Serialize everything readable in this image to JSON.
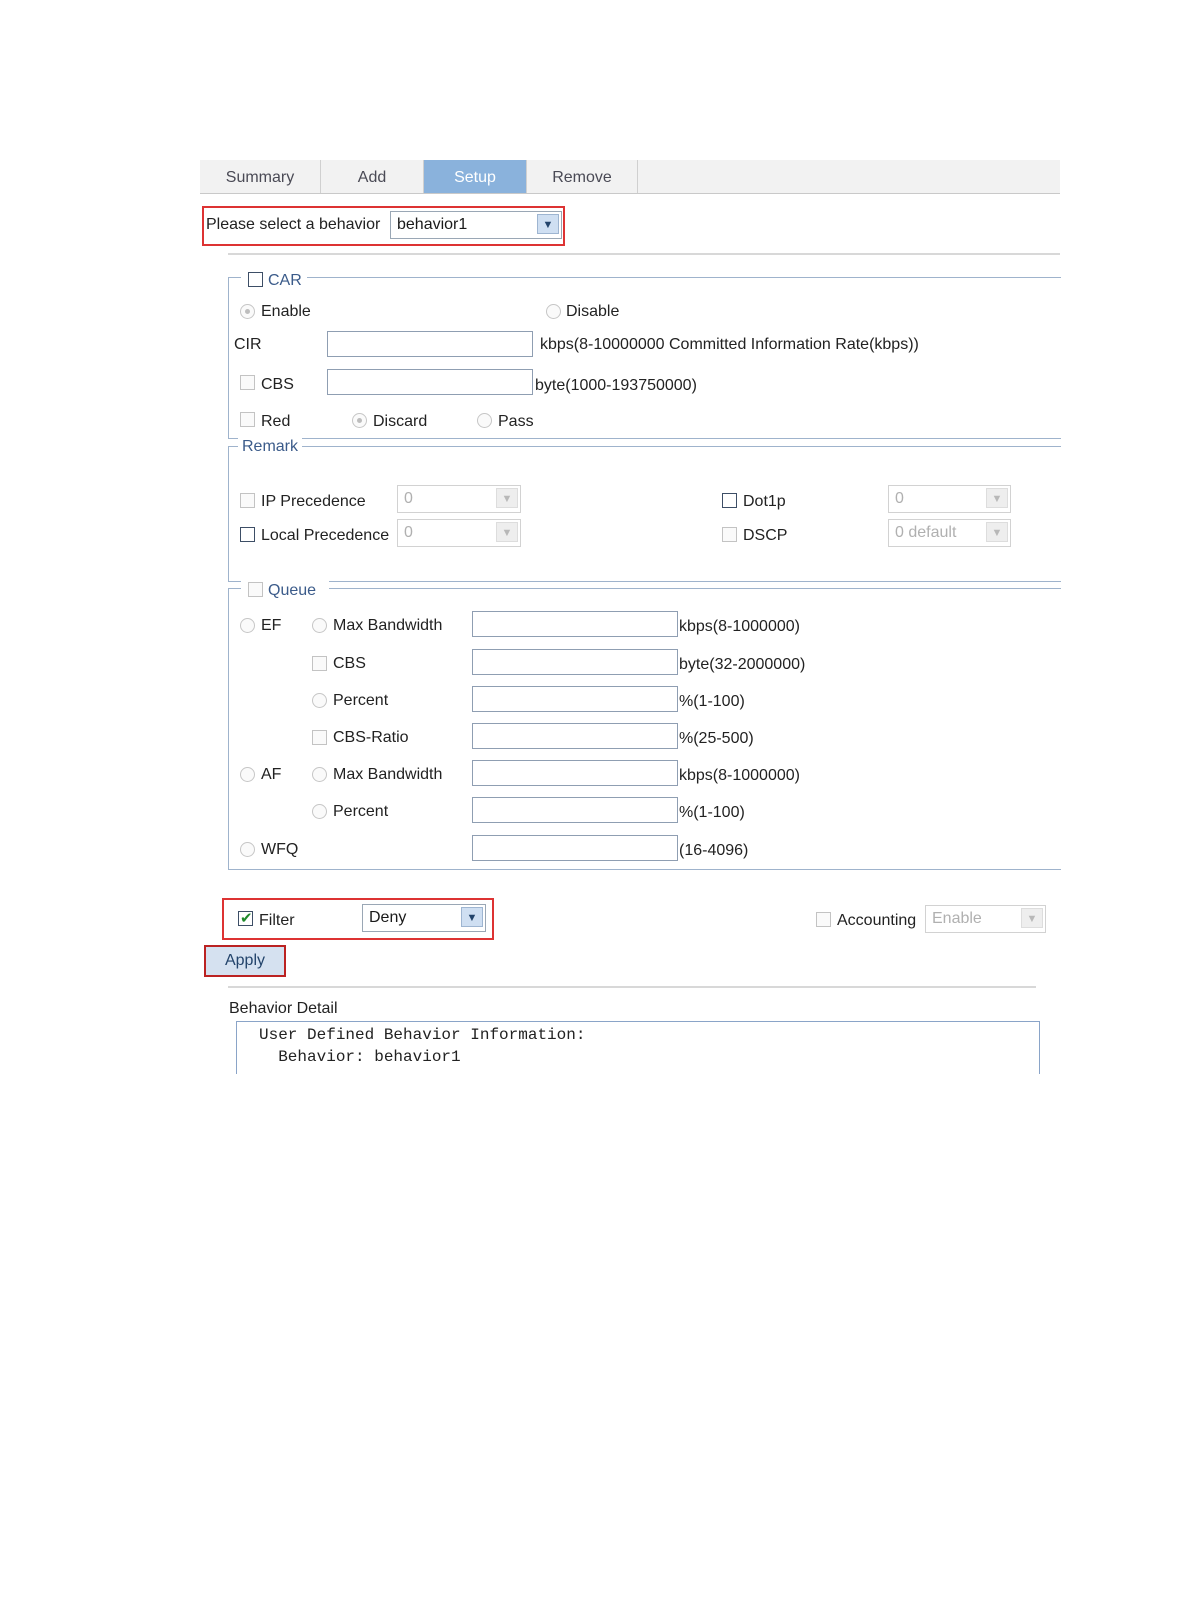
{
  "tabs": [
    {
      "label": "Summary",
      "active": false
    },
    {
      "label": "Add",
      "active": false
    },
    {
      "label": "Setup",
      "active": true
    },
    {
      "label": "Remove",
      "active": false
    }
  ],
  "behavior_select": {
    "label": "Please select a behavior",
    "value": "behavior1"
  },
  "car": {
    "legend": "CAR",
    "enable_label": "Enable",
    "disable_label": "Disable",
    "cir_label": "CIR",
    "cir_value": "",
    "cir_hint": "kbps(8-10000000 Committed Information Rate(kbps))",
    "cbs_label": "CBS",
    "cbs_value": "",
    "cbs_hint": "byte(1000-193750000)",
    "red_label": "Red",
    "discard_label": "Discard",
    "pass_label": "Pass"
  },
  "remark": {
    "legend": "Remark",
    "ip_precedence_label": "IP Precedence",
    "ip_precedence_value": "0",
    "local_precedence_label": "Local Precedence",
    "local_precedence_value": "0",
    "dot1p_label": "Dot1p",
    "dot1p_value": "0",
    "dscp_label": "DSCP",
    "dscp_value": "0 default"
  },
  "queue": {
    "legend": "Queue",
    "ef_label": "EF",
    "af_label": "AF",
    "wfq_label": "WFQ",
    "ef_max_bandwidth_label": "Max Bandwidth",
    "ef_max_bandwidth_hint": "kbps(8-1000000)",
    "ef_cbs_label": "CBS",
    "ef_cbs_hint": "byte(32-2000000)",
    "ef_percent_label": "Percent",
    "ef_percent_hint": "%(1-100)",
    "ef_cbs_ratio_label": "CBS-Ratio",
    "ef_cbs_ratio_hint": "%(25-500)",
    "af_max_bandwidth_label": "Max Bandwidth",
    "af_max_bandwidth_hint": "kbps(8-1000000)",
    "af_percent_label": "Percent",
    "af_percent_hint": "%(1-100)",
    "wfq_hint": "(16-4096)"
  },
  "filter": {
    "label": "Filter",
    "checked": true,
    "value": "Deny"
  },
  "accounting": {
    "label": "Accounting",
    "value": "Enable"
  },
  "apply_label": "Apply",
  "detail": {
    "title": "Behavior Detail",
    "lines": [
      "User Defined Behavior Information:",
      "  Behavior: behavior1"
    ]
  },
  "colors": {
    "active_tab": "#8ab2dc",
    "highlight": "#dd3333",
    "check": "#1f8a2b"
  }
}
